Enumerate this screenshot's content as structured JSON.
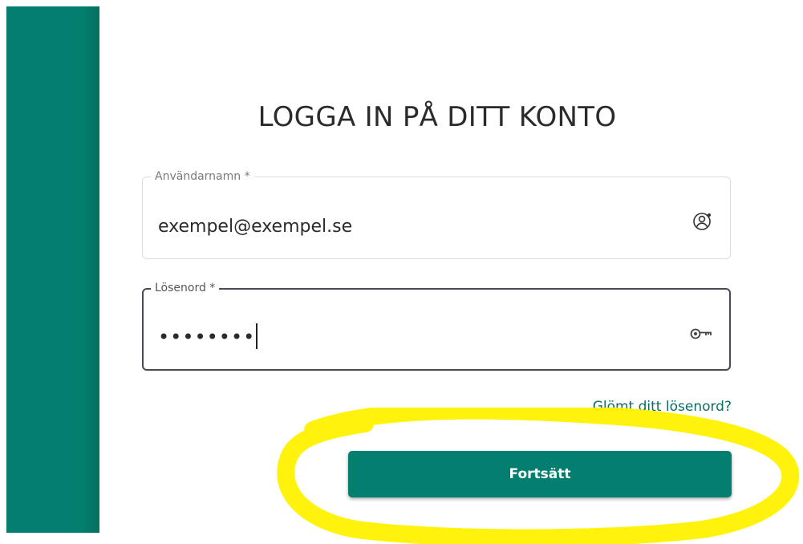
{
  "brand": {
    "accent_color": "#047e6e",
    "highlight_color": "#fff200"
  },
  "login": {
    "title": "LOGGA IN PÅ DITT KONTO",
    "username": {
      "label": "Användarnamn *",
      "value": "exempel@exempel.se",
      "icon": "user-circle-icon"
    },
    "password": {
      "label": "Lösenord *",
      "value": "••••••••",
      "icon": "key-icon"
    },
    "forgot_password_link": "Glömt ditt lösenord?",
    "continue_button": "Fortsätt"
  }
}
